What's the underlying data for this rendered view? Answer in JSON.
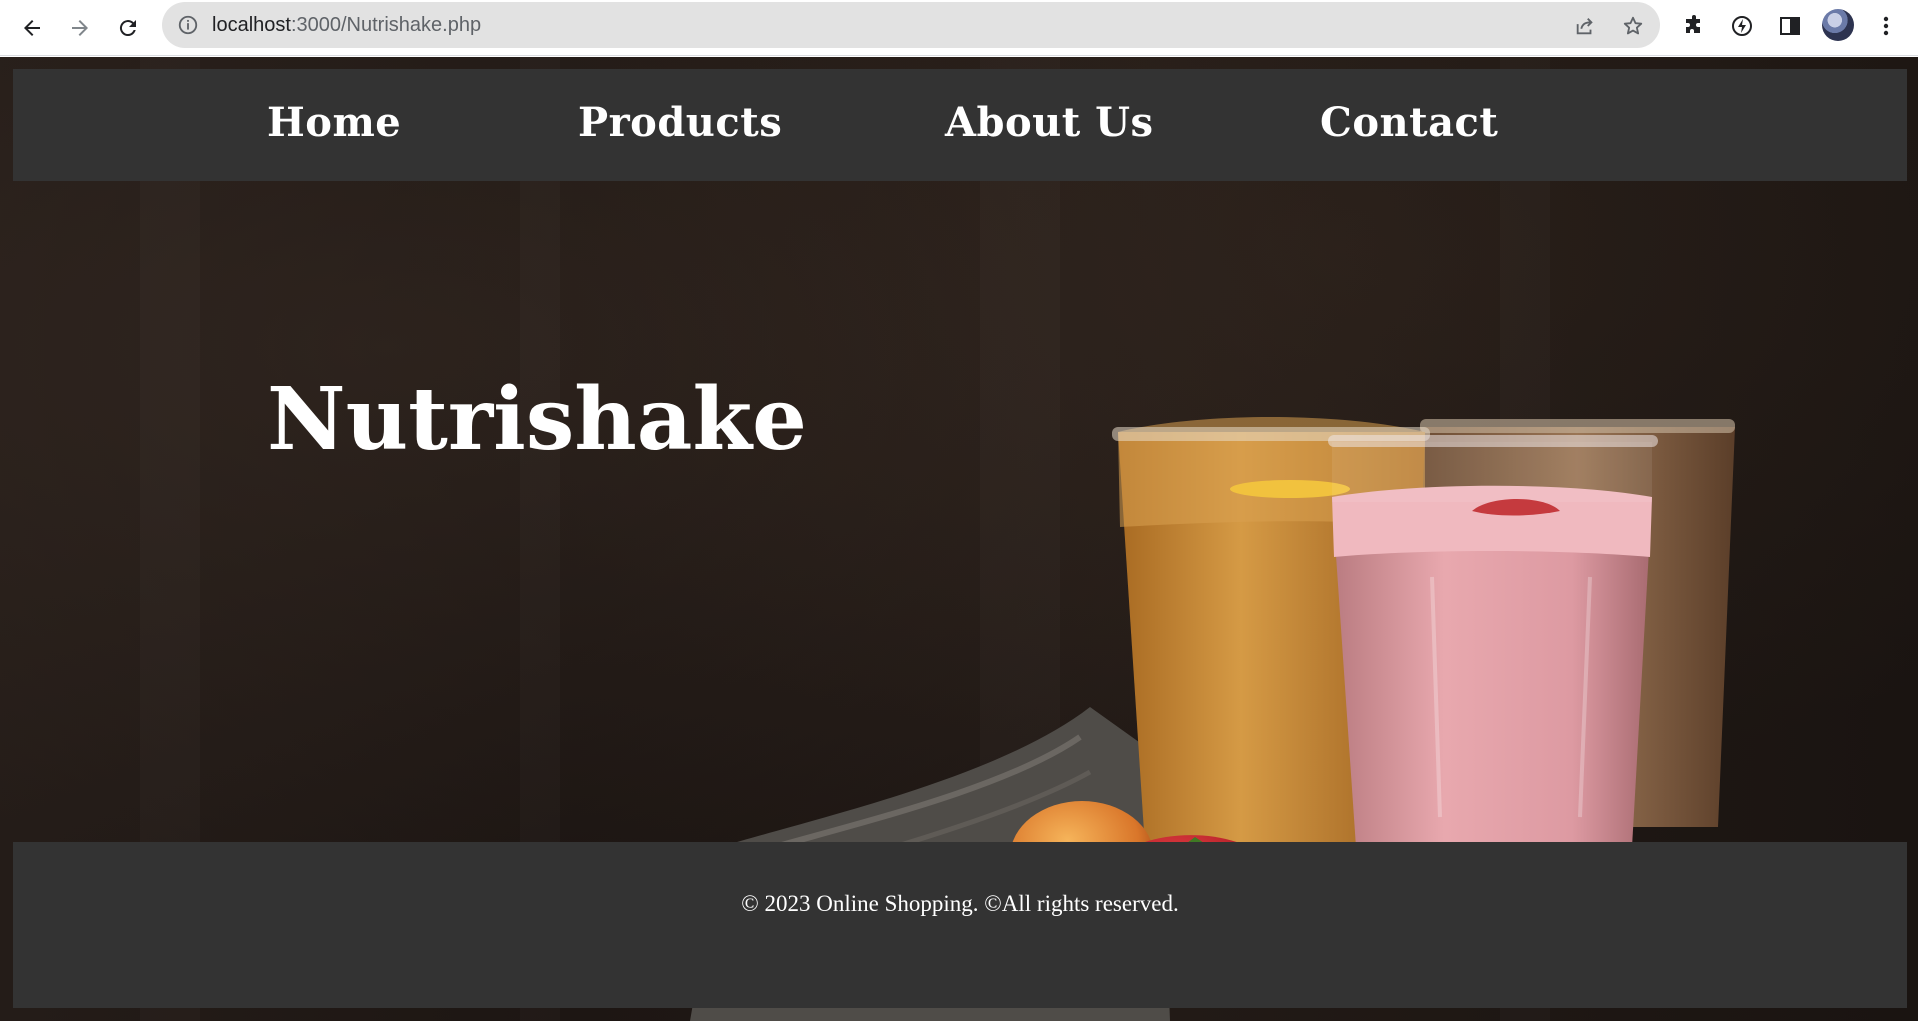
{
  "browser": {
    "url_host": "localhost",
    "url_path": ":3000/Nutrishake.php",
    "icons": [
      "back-icon",
      "forward-icon",
      "reload-icon",
      "info-icon",
      "share-icon",
      "star-icon",
      "extensions-icon",
      "performance-icon",
      "side-panel-icon",
      "avatar",
      "menu-icon"
    ]
  },
  "nav": {
    "items": [
      {
        "label": "Home"
      },
      {
        "label": "Products"
      },
      {
        "label": "About Us"
      },
      {
        "label": "Contact"
      }
    ]
  },
  "hero": {
    "title": "Nutrishake"
  },
  "footer": {
    "text": "© 2023 Online Shopping. ©All rights reserved."
  },
  "colors": {
    "navbar_bg": "#333333",
    "footer_bg": "#333333",
    "text": "#ffffff",
    "background": "#221a16"
  }
}
